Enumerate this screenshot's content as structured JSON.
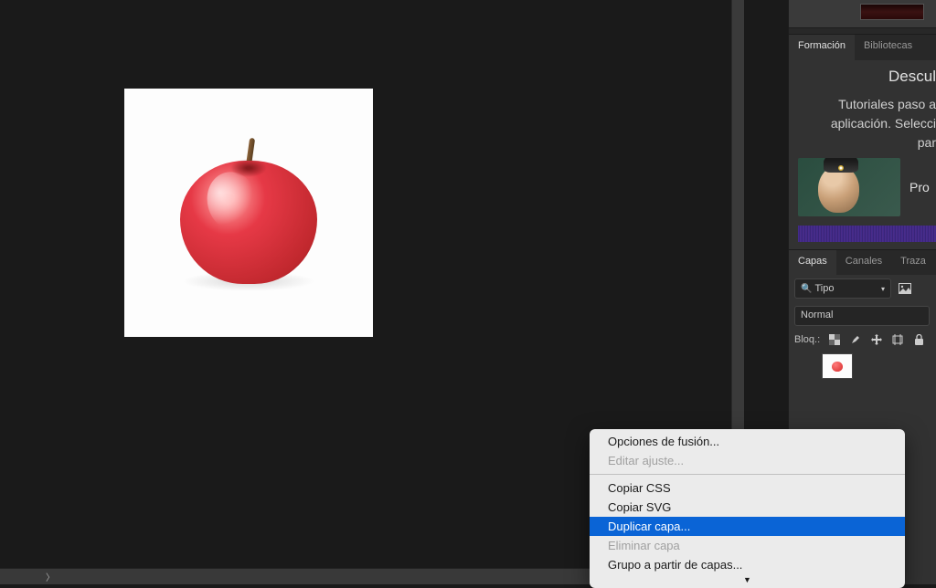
{
  "right_panel": {
    "tabs_top": {
      "formation": "Formación",
      "libraries": "Bibliotecas"
    },
    "formation": {
      "title": "Descul",
      "line1": "Tutoriales paso a",
      "line2": "aplicación. Selecci",
      "line3": "par",
      "tutorial_label": "Pro"
    },
    "tabs_layers": {
      "layers": "Capas",
      "channels": "Canales",
      "paths": "Traza"
    },
    "filter": {
      "type_label": "Tipo"
    },
    "blend_mode": "Normal",
    "lock_label": "Bloq.:"
  },
  "context_menu": {
    "fusion_options": "Opciones de fusión...",
    "edit_adjustment": "Editar ajuste...",
    "copy_css": "Copiar CSS",
    "copy_svg": "Copiar SVG",
    "duplicate_layer": "Duplicar capa...",
    "delete_layer": "Eliminar capa",
    "group_from_layers": "Grupo a partir de capas..."
  },
  "bottom_bar": {
    "chevron": "〉"
  }
}
